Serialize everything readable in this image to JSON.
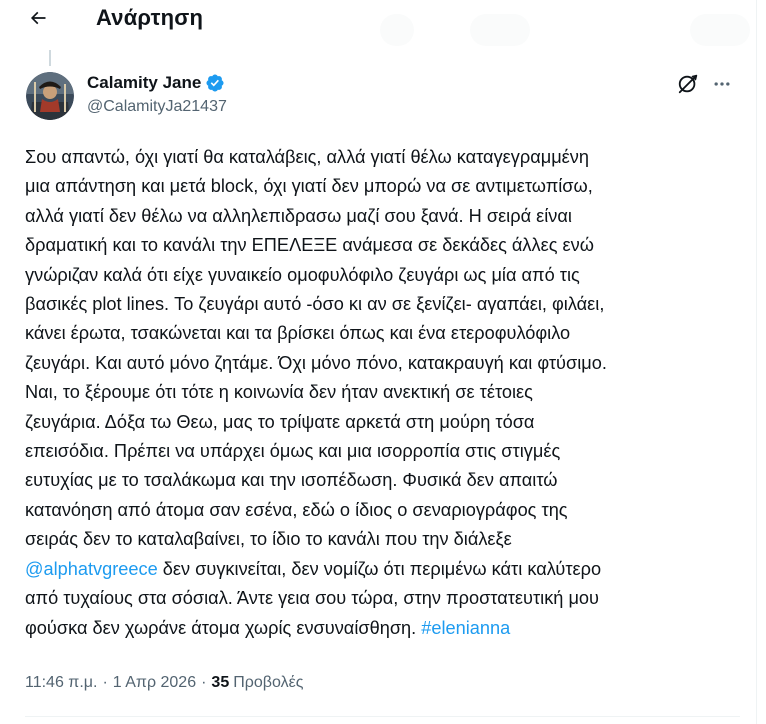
{
  "header": {
    "title": "Ανάρτηση"
  },
  "author": {
    "name": "Calamity Jane",
    "handle": "@CalamityJa21437"
  },
  "tweet": {
    "text_before_mention": "Σου απαντώ, όχι γιατί θα καταλάβεις, αλλά γιατί θέλω καταγεγραμμένη\nμια απάντηση και μετά block, όχι γιατί δεν μπορώ να σε αντιμετωπίσω,\nαλλά γιατί δεν θέλω να αλληλεπιδρασω μαζί σου ξανά. Η σειρά είναι\nδραματική και το κανάλι την ΕΠΕΛΕΞΕ ανάμεσα σε δεκάδες άλλες ενώ\nγνώριζαν καλά ότι είχε γυναικείο ομοφυλόφιλο ζευγάρι ως μία από τις\nβασικές plot lines. Το ζευγάρι αυτό -όσο κι αν σε ξενίζει- αγαπάει, φιλάει,\nκάνει έρωτα, τσακώνεται και τα βρίσκει όπως και ένα ετεροφυλόφιλο\nζευγάρι. Και αυτό μόνο ζητάμε. Όχι μόνο πόνο, κατακραυγή και φτύσιμο.\nΝαι, το ξέρουμε ότι τότε η κοινωνία δεν ήταν ανεκτική σε τέτοιες\nζευγάρια. Δόξα τω Θεω, μας το τρίψατε αρκετά στη μούρη τόσα\nεπεισόδια. Πρέπει να υπάρχει όμως και μια ισορροπία στις στιγμές\nευτυχίας με το τσαλάκωμα και την ισοπέδωση. Φυσικά δεν απαιτώ\nκατανόηση από άτομα σαν εσένα, εδώ ο ίδιος ο σεναριογράφος της\nσειράς δεν το καταλαβαίνει, το ίδιο το κανάλι που την διάλεξε\n",
    "mention": "@alphatvgreece",
    "text_after_mention": " δεν συγκινείται, δεν νομίζω ότι περιμένω κάτι καλύτερο\nαπό τυχαίους στα σόσιαλ. Άντε γεια σου τώρα, στην προστατευτική μου\nφούσκα δεν χωράνε άτομα χωρίς ενσυναίσθηση. ",
    "hashtag": "#elenianna"
  },
  "meta": {
    "time": "11:46 π.μ.",
    "separator": "·",
    "date": "1 Απρ 2026",
    "views_count": "35",
    "views_label": "Προβολές"
  },
  "icons": {
    "back": "back-arrow-icon",
    "verified": "verified-badge-icon",
    "grok": "grok-icon",
    "more": "more-icon"
  },
  "colors": {
    "accent": "#1d9bf0",
    "text_primary": "#0f1419",
    "text_secondary": "#536471",
    "divider": "#eff3f4"
  }
}
